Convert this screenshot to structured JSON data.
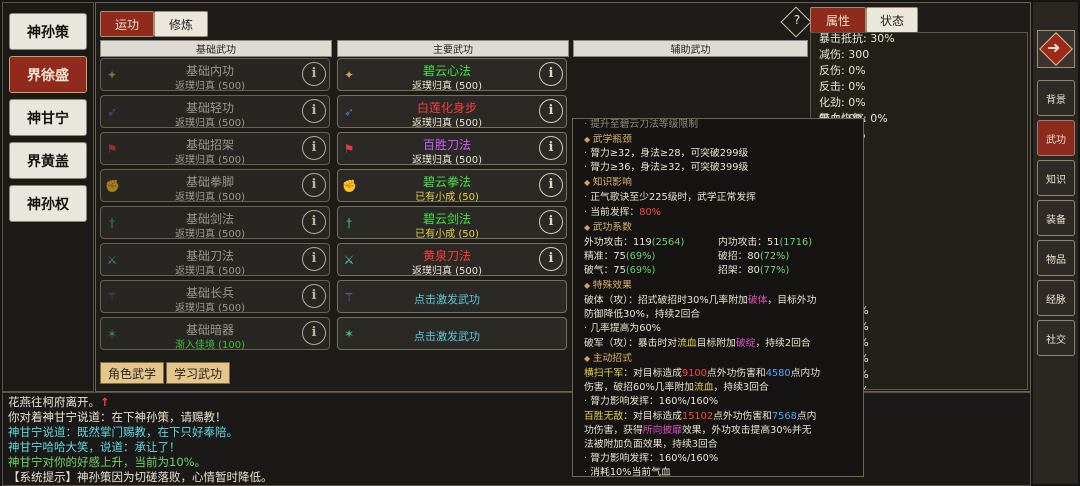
{
  "characters": [
    "神孙策",
    "界徐盛",
    "神甘宁",
    "界黄盖",
    "神孙权"
  ],
  "active_character_index": 1,
  "tabs": {
    "left": [
      "运功",
      "修炼"
    ],
    "right": [
      "属性",
      "状态"
    ],
    "help": "?"
  },
  "columns": {
    "basic": "基础武功",
    "main": "主要武功",
    "aux": "辅助武功"
  },
  "basic_skills": [
    {
      "name": "基础内功",
      "sub": "返璞归真 (500)",
      "icon": "✦",
      "icon_color": "#c9a24a"
    },
    {
      "name": "基础轻功",
      "sub": "返璞归真 (500)",
      "icon": "➶",
      "icon_color": "#4a74d9"
    },
    {
      "name": "基础招架",
      "sub": "返璞归真 (500)",
      "icon": "⚑",
      "icon_color": "#d93f3f"
    },
    {
      "name": "基础拳脚",
      "sub": "返璞归真 (500)",
      "icon": "✊",
      "icon_color": "#3fbf8a"
    },
    {
      "name": "基础剑法",
      "sub": "返璞归真 (500)",
      "icon": "†",
      "icon_color": "#3fbf8a"
    },
    {
      "name": "基础刀法",
      "sub": "返璞归真 (500)",
      "icon": "⚔",
      "icon_color": "#5fbfd9"
    },
    {
      "name": "基础长兵",
      "sub": "返璞归真 (500)",
      "icon": "⚚",
      "icon_color": "#7a74d9"
    },
    {
      "name": "基础暗器",
      "sub": "渐入佳境 (100)",
      "icon": "✶",
      "icon_color": "#3fbf6a"
    }
  ],
  "main_skills": [
    {
      "name": "碧云心法",
      "sub": "返璞归真 (500)",
      "name_color": "#46e046",
      "icon": "✦",
      "icon_color": "#c9a24a"
    },
    {
      "name": "白莲化身步",
      "sub": "返璞归真 (500)",
      "name_color": "#ff3b3b",
      "icon": "➶",
      "icon_color": "#4a74d9"
    },
    {
      "name": "百胜刀法",
      "sub": "返璞归真 (500)",
      "name_color": "#cf5cff",
      "icon": "⚑",
      "icon_color": "#d93f3f"
    },
    {
      "name": "碧云拳法",
      "sub": "已有小成 (50)",
      "name_color": "#46e046",
      "icon": "✊",
      "icon_color": "#3fbf8a"
    },
    {
      "name": "碧云剑法",
      "sub": "已有小成 (50)",
      "name_color": "#46e046",
      "icon": "†",
      "icon_color": "#3fbf8a"
    },
    {
      "name": "黄泉刀法",
      "sub": "返璞归真 (500)",
      "name_color": "#ff3b3b",
      "icon": "⚔",
      "icon_color": "#5fbfd9"
    },
    {
      "name": "点击激发武功",
      "sub": "",
      "name_color": "#5cc7d6",
      "icon": "⚚",
      "icon_color": "#7a74d9"
    },
    {
      "name": "点击激发武功",
      "sub": "",
      "name_color": "#5cc7d6",
      "icon": "✶",
      "icon_color": "#3fbf6a"
    }
  ],
  "buttons": {
    "role_skill": "角色武学",
    "learn_skill": "学习武功"
  },
  "attributes": [
    "暴击抵抗: 30%",
    "减伤: 300",
    "反伤: 0%",
    "反击: 0%",
    "化劲: 0%",
    "气血恢复: 0%",
    "",
    "抗: 15%",
    "抗: 45%",
    "",
    "面: 15",
    "面: 260",
    "面: 5",
    "面: 5",
    "面: 185",
    "面: 5",
    "面: 0",
    "疫: 100%",
    "疫: 100%",
    "疫: 100%",
    "疫: 100%",
    "疫: 100%",
    "疫: 100%",
    "疫: 100%"
  ],
  "attr_partial": [
    "吸血: 0%",
    "免伤: 0%"
  ],
  "nav": [
    "背景",
    "武功",
    "知识",
    "装备",
    "物品",
    "经脉",
    "社交"
  ],
  "nav_active_index": 1,
  "log": [
    {
      "text": "花燕往柯府离开。",
      "extra": "↑",
      "color": "#e8e2d0"
    },
    {
      "text": "你对着神甘宁说道：在下神孙策，请赐教！",
      "color": "#e8e2d0"
    },
    {
      "text": "神甘宁说道：既然掌门赐教，在下只好奉陪。",
      "color": "#5fd8e0"
    },
    {
      "text": "神甘宁哈哈大笑，说道：承让了！",
      "color": "#5fd8e0"
    },
    {
      "text": "神甘宁对你的好感上升，当前为10%。",
      "color": "#6ed16c"
    },
    {
      "text": "【系统提示】神孙策因为切磋落败，心情暂时降低。",
      "color": "#e8e2d0"
    }
  ],
  "tooltip": {
    "top_cut": "· 提升至碧云刀法等级限制",
    "sections": [
      {
        "title": "武学瓶颈",
        "lines": [
          "· 膂力≥32，身法≥28，可突破299级",
          "· 膂力≥36，身法≥32，可突破399级"
        ]
      },
      {
        "title": "知识影响",
        "lines": [
          "· 正气歌诀至少225级时，武学正常发挥",
          "· 当前发挥："
        ]
      },
      {
        "title": "武功系数",
        "lines": []
      },
      {
        "title": "特殊效果",
        "lines": []
      },
      {
        "title": "主动招式",
        "lines": []
      }
    ],
    "current_perf": "80%",
    "coef": {
      "wai_label": "外功攻击：119",
      "wai_val": "(2564)",
      "nei_label": "内功攻击：51",
      "nei_val": "(1716)",
      "jz_label": "精准：75",
      "jz_val": "(69%)",
      "pz_label": "破招：80",
      "pz_val": "(72%)",
      "pq_label": "破气：75",
      "pq_val": "(69%)",
      "zj_label": "招架：80",
      "zj_val": "(77%)"
    },
    "special": [
      {
        "a": "破体（攻）：招式破招时30%几率附加",
        "b": "破体",
        "c": "，目标外功"
      },
      {
        "a": "防御降低30%，持续2回合"
      },
      {
        "a": "· 几率提高为60%"
      },
      {
        "a": "破军（攻）：暴击时对",
        "b": "流血",
        "c": "目标附加",
        "d": "破绽",
        "e": "，持续2回合"
      }
    ],
    "moves": {
      "m1_name": "横扫千军",
      "m1_a": "：对目标造成",
      "m1_v1": "9100",
      "m1_b": "点外功伤害和",
      "m1_v2": "4580",
      "m1_c": "点内功",
      "m1_l2a": "伤害，破招60%几率附加",
      "m1_l2b": "流血",
      "m1_l2c": "，持续3回合",
      "m1_perf": "· 膂力影响发挥：160%/160%",
      "m2_name": "百胜无敌",
      "m2_a": "：对目标造成",
      "m2_v1": "15102",
      "m2_b": "点外功伤害和",
      "m2_v2": "7568",
      "m2_c": "点内",
      "m2_l2a": "功伤害，获得",
      "m2_l2b": "所向披靡",
      "m2_l2c": "效果，外功攻击提高30%并无",
      "m2_l3": "法被附加负面效果，持续3回合",
      "m2_perf": "· 膂力影响发挥：160%/160%",
      "cost": "· 消耗10%当前气血"
    }
  }
}
